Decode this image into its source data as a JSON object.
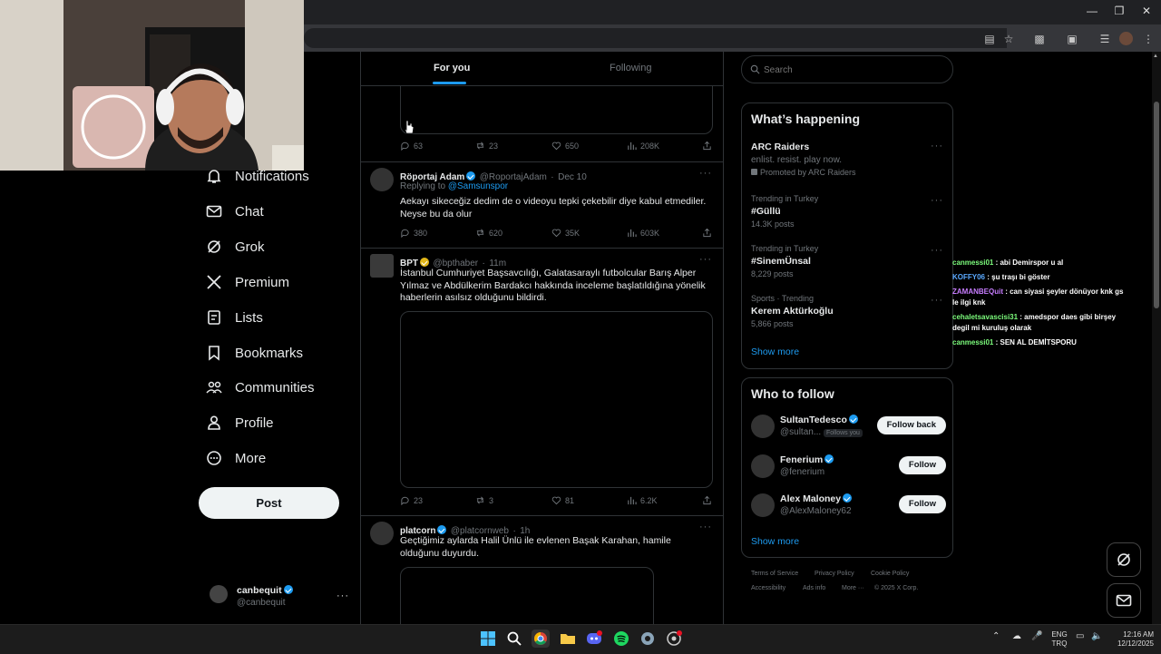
{
  "feed_tabs": {
    "for_you": "For you",
    "following": "Following"
  },
  "nav": {
    "notifications": "Notifications",
    "chat": "Chat",
    "grok": "Grok",
    "premium": "Premium",
    "lists": "Lists",
    "bookmarks": "Bookmarks",
    "communities": "Communities",
    "profile": "Profile",
    "more": "More",
    "post": "Post"
  },
  "account": {
    "name": "canbequit",
    "handle": "@canbequit"
  },
  "tweets": [
    {
      "replies": "63",
      "reposts": "23",
      "likes": "650",
      "views": "208K"
    },
    {
      "name": "Röportaj Adam",
      "handle": "@RoportajAdam",
      "time": "Dec 10",
      "replying_prefix": "Replying to ",
      "replying_to": "@Samsunspor",
      "text": "Aekayı sikeceğiz dedim de o videoyu tepki çekebilir diye kabul etmediler. Neyse bu da olur",
      "replies": "380",
      "reposts": "620",
      "likes": "35K",
      "views": "603K"
    },
    {
      "name": "BPT",
      "handle": "@bpthaber",
      "time": "11m",
      "text": "İstanbul Cumhuriyet Başsavcılığı, Galatasaraylı futbolcular Barış Alper Yılmaz ve Abdülkerim Bardakcı hakkında inceleme başlatıldığına yönelik haberlerin asılsız olduğunu bildirdi.",
      "replies": "23",
      "reposts": "3",
      "likes": "81",
      "views": "6.2K"
    },
    {
      "name": "platcorn",
      "handle": "@platcornweb",
      "time": "1h",
      "text": "Geçtiğimiz aylarda Halil Ünlü ile evlenen Başak Karahan, hamile olduğunu duyurdu."
    }
  ],
  "search": {
    "placeholder": "Search"
  },
  "whats_happening": {
    "title": "What’s happening",
    "promo": {
      "topic": "ARC Raiders",
      "sub": "enlist. resist. play now.",
      "promoted": "Promoted by ARC Raiders"
    },
    "trends": [
      {
        "meta": "Trending in Turkey",
        "topic": "#Güllü",
        "posts": "14.3K posts"
      },
      {
        "meta": "Trending in Turkey",
        "topic": "#SinemÜnsal",
        "posts": "8,229 posts"
      },
      {
        "meta": "Sports · Trending",
        "topic": "Kerem Aktürkoğlu",
        "posts": "5,866 posts"
      }
    ],
    "show_more": "Show more"
  },
  "who_to_follow": {
    "title": "Who to follow",
    "users": [
      {
        "name": "SultanTedesco",
        "handle": "@sultan...",
        "badge": "Follows you",
        "button": "Follow back"
      },
      {
        "name": "Fenerium",
        "handle": "@fenerium",
        "button": "Follow"
      },
      {
        "name": "Alex Maloney",
        "handle": "@AlexMaloney62",
        "button": "Follow"
      }
    ],
    "show_more": "Show more"
  },
  "footer_links": [
    "Terms of Service",
    "Privacy Policy",
    "Cookie Policy",
    "Accessibility",
    "Ads info",
    "More ···",
    "© 2025 X Corp."
  ],
  "chat_overlay": [
    {
      "user": "canmessi01",
      "msg": " : abi Demirspor u al",
      "color": "#7cfc7c"
    },
    {
      "user": "KOFFY06",
      "msg": " : şu traşı bi göster",
      "color": "#5aa9ff"
    },
    {
      "user": "ZAMANBEQuit",
      "msg": " : can siyasi şeyler dönüyor knk gs le ilgi knk",
      "color": "#c77dff"
    },
    {
      "user": "cehaletsavascisi31",
      "msg": " : amedspor daes gibi birşey degil mi kuruluş olarak",
      "color": "#7cfc7c"
    },
    {
      "user": "canmessi01",
      "msg": " : SEN AL DEMİTSPORU",
      "color": "#7cfc7c"
    }
  ],
  "taskbar": {
    "lang1": "ENG",
    "lang2": "TRQ",
    "time": "12:16 AM",
    "date": "12/12/2025"
  },
  "colors": {
    "accent": "#1d9bf0",
    "background": "#000000",
    "border": "#2f3336"
  }
}
